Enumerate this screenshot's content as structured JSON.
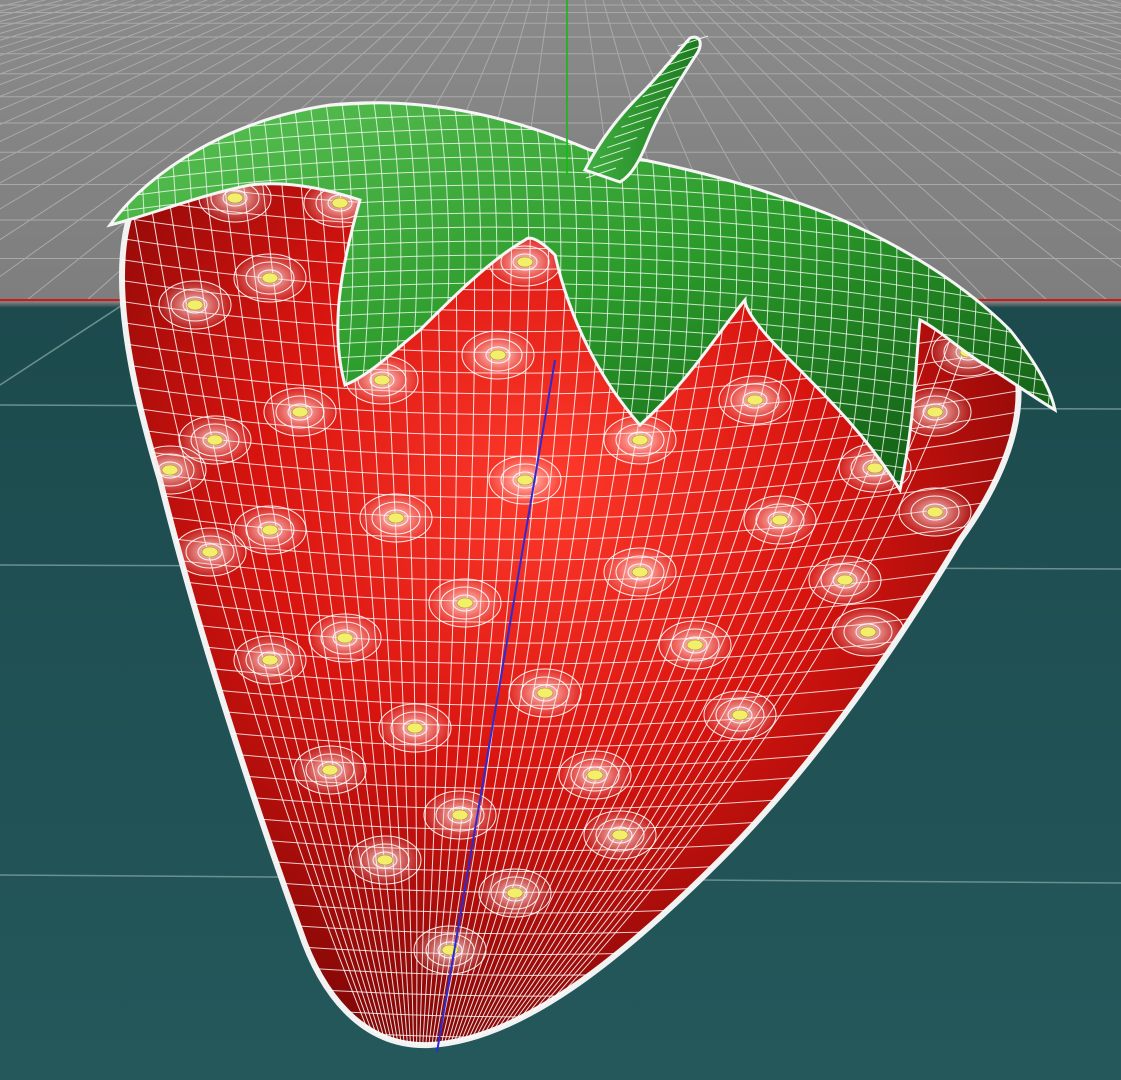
{
  "viewport": {
    "colors": {
      "background_top": "#8d8d8d",
      "background_bottom": "#1f5356",
      "grid_line": "#a9a9a9",
      "floor_grid_line": "#6c8f90",
      "axis_x": "#d01818",
      "axis_y": "#18b818",
      "axis_z": "#2b2bd6"
    }
  },
  "model": {
    "colors": {
      "body_highlight": "#ff3a2a",
      "body_mid": "#d8140f",
      "body_shadow": "#7a0606",
      "leaf_light": "#4fb84a",
      "leaf_mid": "#2a9b2a",
      "leaf_dark": "#0f5a12",
      "wireframe": "#ffffff",
      "seed": "#f4ef6a"
    },
    "wireframe_visible": true
  }
}
